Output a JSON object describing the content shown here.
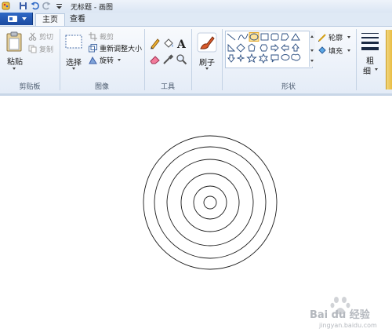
{
  "window": {
    "title": "无标题 - 画图"
  },
  "tabs": [
    {
      "label": "主页",
      "active": true
    },
    {
      "label": "查看",
      "active": false
    }
  ],
  "ribbon": {
    "clipboard": {
      "label": "剪贴板",
      "paste": "粘贴",
      "cut": "剪切",
      "copy": "复制"
    },
    "image": {
      "label": "图像",
      "select": "选择",
      "crop": "裁剪",
      "resize": "重新调整大小",
      "rotate": "旋转"
    },
    "tools": {
      "label": "工具"
    },
    "brush": {
      "label": "刷子"
    },
    "shapes": {
      "label": "形状",
      "outline": "轮廓",
      "fill": "填充"
    },
    "size": {
      "label_line1": "粗",
      "label_line2": "细"
    }
  },
  "canvas": {
    "circles": 6
  },
  "watermark": {
    "text": "Bai du 经验",
    "url": "jingyan.baidu.com"
  },
  "colors": {
    "accent": "#2f69c6",
    "ribbon": "#e4ecf7",
    "selected_shape": "#f5b91d"
  }
}
